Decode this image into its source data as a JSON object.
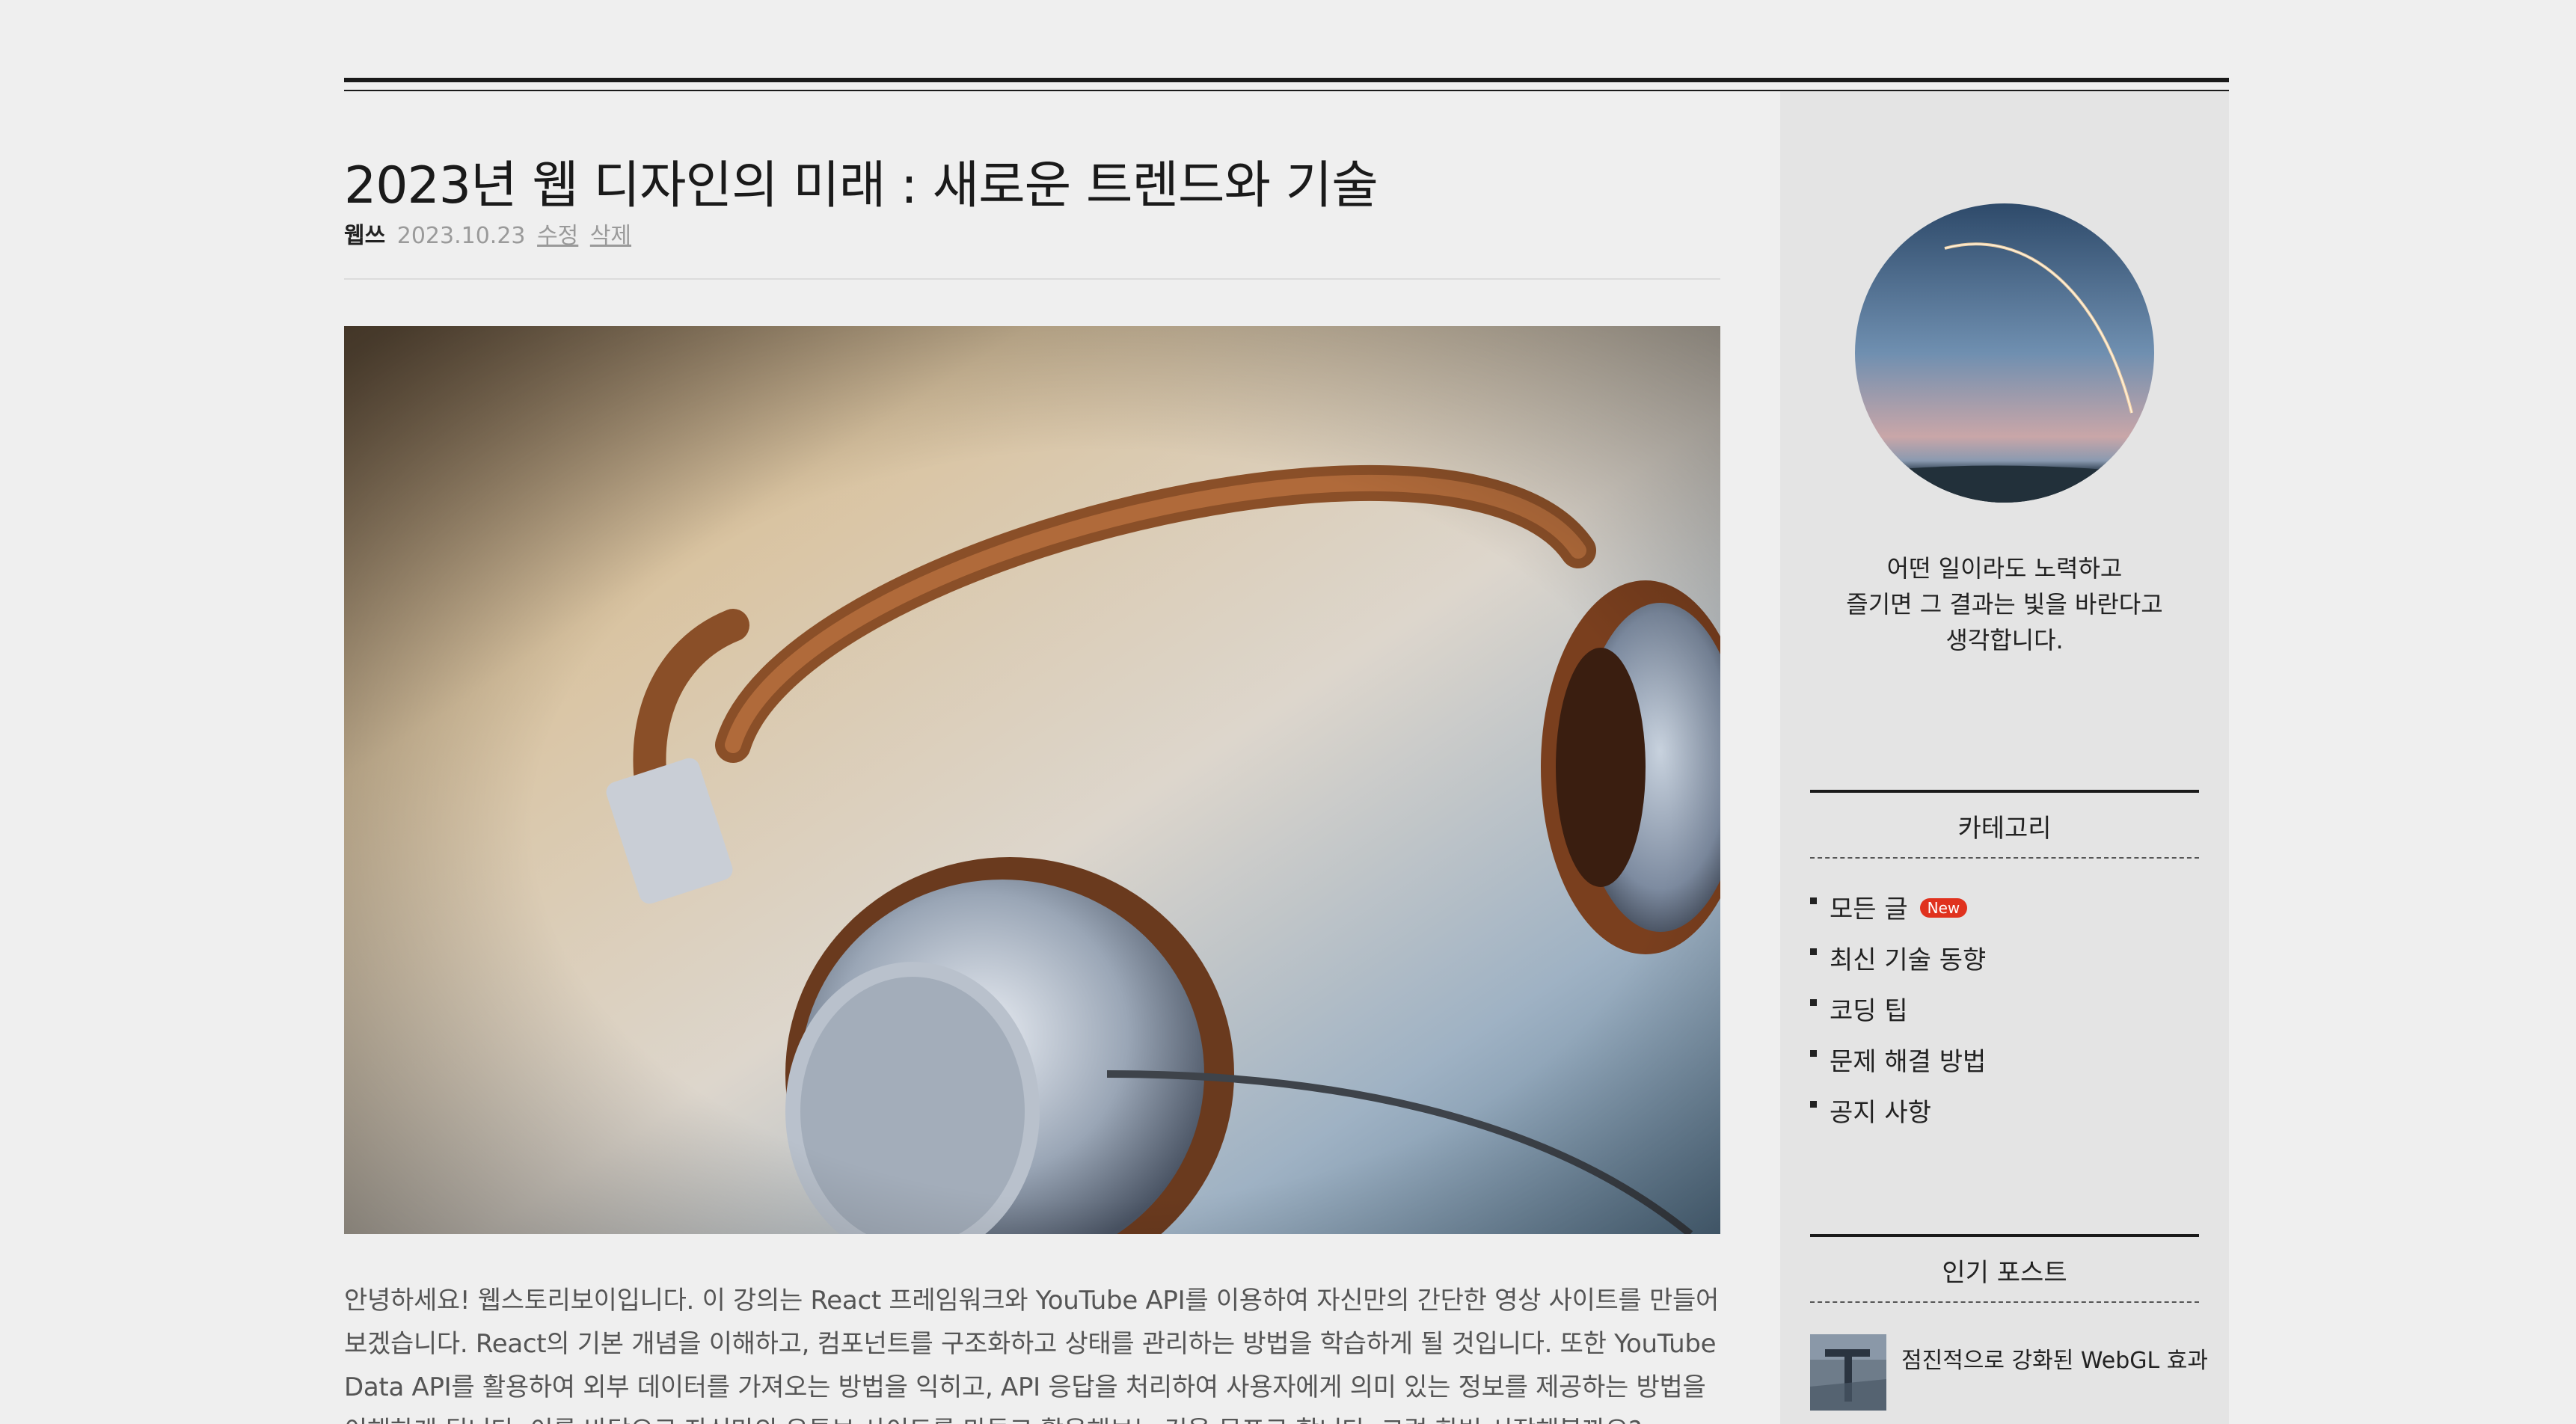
{
  "post": {
    "title": "2023년 웹 디자인의 미래 : 새로운 트렌드와 기술",
    "author": "웹쓰",
    "date": "2023.10.23",
    "edit_label": "수정",
    "delete_label": "삭제",
    "body": "안녕하세요! 웹스토리보이입니다. 이 강의는 React 프레임워크와 YouTube API를 이용하여 자신만의 간단한 영상 사이트를 만들어보겠습니다. React의 기본 개념을 이해하고, 컴포넌트를 구조화하고 상태를 관리하는 방법을 학습하게 될 것입니다. 또한 YouTube Data API를 활용하여 외부 데이터를 가져오는 방법을 익히고, API 응답을 처리하여 사용자에게 의미 있는 정보를 제공하는 방법을 이해하게 됩니다. 이를 바탕으로 자신만의 유튜브 사이트를 만들고 활용해보는 것을 목표로 합니다. 그럼 한번 시작해볼까요?"
  },
  "sidebar": {
    "motto_lines": [
      "어떤 일이라도 노력하고",
      "즐기면 그 결과는 빛을 바란다고",
      "생각합니다."
    ],
    "category_title": "카테고리",
    "categories": [
      {
        "label": "모든 글",
        "badge": "New"
      },
      {
        "label": "최신 기술 동향"
      },
      {
        "label": "코딩 팁"
      },
      {
        "label": "문제 해결 방법"
      },
      {
        "label": "공지 사항"
      }
    ],
    "popular_title": "인기 포스트",
    "popular_posts": [
      {
        "title": "점진적으로 강화된 WebGL 효과"
      }
    ]
  }
}
